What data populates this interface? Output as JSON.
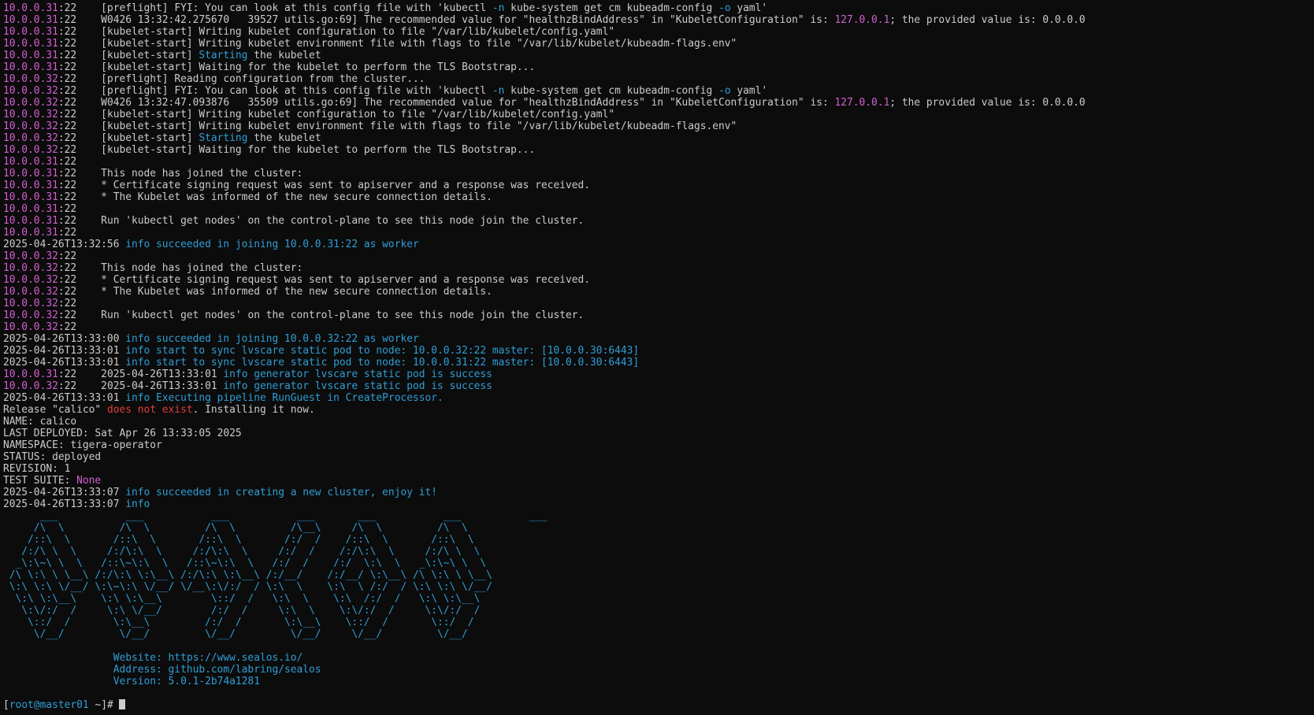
{
  "colors": {
    "background": "#0c0c0c",
    "default_text": "#cccccc",
    "magenta": "#d45fd0",
    "cyan": "#2f9ed6",
    "red": "#e0403b"
  },
  "lines": [
    [
      {
        "t": "10.0.0.31",
        "c": "magenta"
      },
      {
        "t": ":22    [preflight] FYI: You can look at this config file with 'kubectl "
      },
      {
        "t": "-n",
        "c": "cyan"
      },
      {
        "t": " kube-system get cm kubeadm-config "
      },
      {
        "t": "-o",
        "c": "cyan"
      },
      {
        "t": " yaml'"
      }
    ],
    [
      {
        "t": "10.0.0.31",
        "c": "magenta"
      },
      {
        "t": ":22    W0426 13:32:42.275670   39527 utils.go:69] The recommended value for \"healthzBindAddress\" in \"KubeletConfiguration\" is: "
      },
      {
        "t": "127.0.0.1",
        "c": "magenta"
      },
      {
        "t": "; the provided value is: 0.0.0.0"
      }
    ],
    [
      {
        "t": "10.0.0.31",
        "c": "magenta"
      },
      {
        "t": ":22    [kubelet-start] Writing kubelet configuration to file \"/var/lib/kubelet/config.yaml\""
      }
    ],
    [
      {
        "t": "10.0.0.31",
        "c": "magenta"
      },
      {
        "t": ":22    [kubelet-start] Writing kubelet environment file with flags to file \"/var/lib/kubelet/kubeadm-flags.env\""
      }
    ],
    [
      {
        "t": "10.0.0.31",
        "c": "magenta"
      },
      {
        "t": ":22    [kubelet-start] "
      },
      {
        "t": "Starting",
        "c": "cyan"
      },
      {
        "t": " the kubelet"
      }
    ],
    [
      {
        "t": "10.0.0.31",
        "c": "magenta"
      },
      {
        "t": ":22    [kubelet-start] Waiting for the kubelet to perform the TLS Bootstrap..."
      }
    ],
    [
      {
        "t": "10.0.0.32",
        "c": "magenta"
      },
      {
        "t": ":22    [preflight] Reading configuration from the cluster..."
      }
    ],
    [
      {
        "t": "10.0.0.32",
        "c": "magenta"
      },
      {
        "t": ":22    [preflight] FYI: You can look at this config file with 'kubectl "
      },
      {
        "t": "-n",
        "c": "cyan"
      },
      {
        "t": " kube-system get cm kubeadm-config "
      },
      {
        "t": "-o",
        "c": "cyan"
      },
      {
        "t": " yaml'"
      }
    ],
    [
      {
        "t": "10.0.0.32",
        "c": "magenta"
      },
      {
        "t": ":22    W0426 13:32:47.093876   35509 utils.go:69] The recommended value for \"healthzBindAddress\" in \"KubeletConfiguration\" is: "
      },
      {
        "t": "127.0.0.1",
        "c": "magenta"
      },
      {
        "t": "; the provided value is: 0.0.0.0"
      }
    ],
    [
      {
        "t": "10.0.0.32",
        "c": "magenta"
      },
      {
        "t": ":22    [kubelet-start] Writing kubelet configuration to file \"/var/lib/kubelet/config.yaml\""
      }
    ],
    [
      {
        "t": "10.0.0.32",
        "c": "magenta"
      },
      {
        "t": ":22    [kubelet-start] Writing kubelet environment file with flags to file \"/var/lib/kubelet/kubeadm-flags.env\""
      }
    ],
    [
      {
        "t": "10.0.0.32",
        "c": "magenta"
      },
      {
        "t": ":22    [kubelet-start] "
      },
      {
        "t": "Starting",
        "c": "cyan"
      },
      {
        "t": " the kubelet"
      }
    ],
    [
      {
        "t": "10.0.0.32",
        "c": "magenta"
      },
      {
        "t": ":22    [kubelet-start] Waiting for the kubelet to perform the TLS Bootstrap..."
      }
    ],
    [
      {
        "t": "10.0.0.31",
        "c": "magenta"
      },
      {
        "t": ":22"
      }
    ],
    [
      {
        "t": "10.0.0.31",
        "c": "magenta"
      },
      {
        "t": ":22    This node has joined the cluster:"
      }
    ],
    [
      {
        "t": "10.0.0.31",
        "c": "magenta"
      },
      {
        "t": ":22    * Certificate signing request was sent to apiserver and a response was received."
      }
    ],
    [
      {
        "t": "10.0.0.31",
        "c": "magenta"
      },
      {
        "t": ":22    * The Kubelet was informed of the new secure connection details."
      }
    ],
    [
      {
        "t": "10.0.0.31",
        "c": "magenta"
      },
      {
        "t": ":22"
      }
    ],
    [
      {
        "t": "10.0.0.31",
        "c": "magenta"
      },
      {
        "t": ":22    Run 'kubectl get nodes' on the control-plane to see this node join the cluster."
      }
    ],
    [
      {
        "t": "10.0.0.31",
        "c": "magenta"
      },
      {
        "t": ":22"
      }
    ],
    [
      {
        "t": "2025-04-26T13:32:56 "
      },
      {
        "t": "info succeeded in joining 10.0.0.31:22 as worker",
        "c": "cyan"
      }
    ],
    [
      {
        "t": "10.0.0.32",
        "c": "magenta"
      },
      {
        "t": ":22"
      }
    ],
    [
      {
        "t": "10.0.0.32",
        "c": "magenta"
      },
      {
        "t": ":22    This node has joined the cluster:"
      }
    ],
    [
      {
        "t": "10.0.0.32",
        "c": "magenta"
      },
      {
        "t": ":22    * Certificate signing request was sent to apiserver and a response was received."
      }
    ],
    [
      {
        "t": "10.0.0.32",
        "c": "magenta"
      },
      {
        "t": ":22    * The Kubelet was informed of the new secure connection details."
      }
    ],
    [
      {
        "t": "10.0.0.32",
        "c": "magenta"
      },
      {
        "t": ":22"
      }
    ],
    [
      {
        "t": "10.0.0.32",
        "c": "magenta"
      },
      {
        "t": ":22    Run 'kubectl get nodes' on the control-plane to see this node join the cluster."
      }
    ],
    [
      {
        "t": "10.0.0.32",
        "c": "magenta"
      },
      {
        "t": ":22"
      }
    ],
    [
      {
        "t": "2025-04-26T13:33:00 "
      },
      {
        "t": "info succeeded in joining 10.0.0.32:22 as worker",
        "c": "cyan"
      }
    ],
    [
      {
        "t": "2025-04-26T13:33:01 "
      },
      {
        "t": "info start to sync lvscare static pod to node: 10.0.0.32:22 master: [10.0.0.30:6443]",
        "c": "cyan"
      }
    ],
    [
      {
        "t": "2025-04-26T13:33:01 "
      },
      {
        "t": "info start to sync lvscare static pod to node: 10.0.0.31:22 master: [10.0.0.30:6443]",
        "c": "cyan"
      }
    ],
    [
      {
        "t": "10.0.0.31",
        "c": "magenta"
      },
      {
        "t": ":22    2025-04-26T13:33:01 "
      },
      {
        "t": "info generator lvscare static pod is success",
        "c": "cyan"
      }
    ],
    [
      {
        "t": "10.0.0.32",
        "c": "magenta"
      },
      {
        "t": ":22    2025-04-26T13:33:01 "
      },
      {
        "t": "info generator lvscare static pod is success",
        "c": "cyan"
      }
    ],
    [
      {
        "t": "2025-04-26T13:33:01 "
      },
      {
        "t": "info Executing pipeline RunGuest in CreateProcessor.",
        "c": "cyan"
      }
    ],
    [
      {
        "t": "Release \"calico\" "
      },
      {
        "t": "does not exist",
        "c": "red"
      },
      {
        "t": ". Installing it now."
      }
    ],
    [
      {
        "t": "NAME: calico"
      }
    ],
    [
      {
        "t": "LAST DEPLOYED: Sat Apr 26 13:33:05 2025"
      }
    ],
    [
      {
        "t": "NAMESPACE: tigera-operator"
      }
    ],
    [
      {
        "t": "STATUS: deployed"
      }
    ],
    [
      {
        "t": "REVISION: 1"
      }
    ],
    [
      {
        "t": "TEST SUITE: "
      },
      {
        "t": "None",
        "c": "magenta"
      }
    ],
    [
      {
        "t": "2025-04-26T13:33:07 "
      },
      {
        "t": "info succeeded in creating a new cluster, enjoy it!",
        "c": "cyan"
      }
    ],
    [
      {
        "t": "2025-04-26T13:33:07 "
      },
      {
        "t": "info",
        "c": "cyan"
      }
    ],
    [
      {
        "t": "      ___           ___           ___           ___       ___           ___           ___     ",
        "c": "cyan"
      }
    ],
    [
      {
        "t": "     /\\  \\         /\\  \\         /\\  \\         /\\__\\     /\\  \\         /\\  \\    ",
        "c": "cyan"
      }
    ],
    [
      {
        "t": "    /::\\  \\       /::\\  \\       /::\\  \\       /:/  /    /::\\  \\       /::\\  \\   ",
        "c": "cyan"
      }
    ],
    [
      {
        "t": "   /:/\\ \\  \\     /:/\\:\\  \\     /:/\\:\\  \\     /:/  /    /:/\\:\\  \\     /:/\\ \\  \\  ",
        "c": "cyan"
      }
    ],
    [
      {
        "t": "  _\\:\\~\\ \\  \\   /::\\~\\:\\  \\   /::\\~\\:\\  \\   /:/  /    /:/  \\:\\  \\   _\\:\\~\\ \\  \\ ",
        "c": "cyan"
      }
    ],
    [
      {
        "t": " /\\ \\:\\ \\ \\__\\ /:/\\:\\ \\:\\__\\ /:/\\:\\ \\:\\__\\ /:/__/    /:/__/ \\:\\__\\ /\\ \\:\\ \\ \\__\\",
        "c": "cyan"
      }
    ],
    [
      {
        "t": " \\:\\ \\:\\ \\/__/ \\:\\~\\:\\ \\/__/ \\/__\\:\\/:/  / \\:\\  \\    \\:\\  \\ /:/  / \\:\\ \\:\\ \\/__/",
        "c": "cyan"
      }
    ],
    [
      {
        "t": "  \\:\\ \\:\\__\\    \\:\\ \\:\\__\\        \\::/  /   \\:\\  \\    \\:\\  /:/  /   \\:\\ \\:\\__\\  ",
        "c": "cyan"
      }
    ],
    [
      {
        "t": "   \\:\\/:/  /     \\:\\ \\/__/        /:/  /     \\:\\  \\    \\:\\/:/  /     \\:\\/:/  /  ",
        "c": "cyan"
      }
    ],
    [
      {
        "t": "    \\::/  /       \\:\\__\\         /:/  /       \\:\\__\\    \\::/  /       \\::/  /   ",
        "c": "cyan"
      }
    ],
    [
      {
        "t": "     \\/__/         \\/__/         \\/__/         \\/__/     \\/__/         \\/__/    ",
        "c": "cyan"
      }
    ],
    [
      {
        "t": ""
      }
    ],
    [
      {
        "t": "                  Website: https://www.sealos.io/",
        "c": "cyan"
      }
    ],
    [
      {
        "t": "                  Address: github.com/labring/sealos",
        "c": "cyan"
      }
    ],
    [
      {
        "t": "                  Version: 5.0.1-2b74a1281",
        "c": "cyan"
      }
    ],
    [
      {
        "t": ""
      }
    ],
    [
      {
        "t": "["
      },
      {
        "t": "root@master01",
        "c": "cyan"
      },
      {
        "t": " ~]# "
      }
    ]
  ]
}
